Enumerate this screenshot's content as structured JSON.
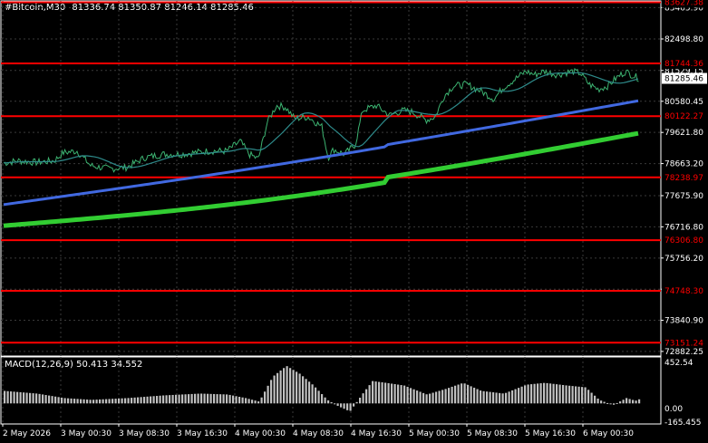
{
  "header": {
    "symbol": "#Bitcoin,M30",
    "open": "81336.74",
    "high": "81350.87",
    "low": "81246.14",
    "close": "81285.46"
  },
  "macd": {
    "label": "MACD(12,26,9)",
    "main": "50.413",
    "signal": "34.552",
    "ticks": [
      "452.54",
      "0.00",
      "-165.455"
    ]
  },
  "price_axis": {
    "ticks": [
      "83465.90",
      "82498.80",
      "81529.15",
      "80580.45",
      "79621.80",
      "78663.20",
      "77675.90",
      "76716.80",
      "75756.20",
      "74797.40",
      "73840.90",
      "72882.25"
    ],
    "current_price": "81285.46"
  },
  "levels": [
    {
      "label": "83627.38",
      "price": 83627.38
    },
    {
      "label": "81744.36",
      "price": 81744.36
    },
    {
      "label": "80122.27",
      "price": 80122.27
    },
    {
      "label": "78238.97",
      "price": 78238.97
    },
    {
      "label": "76306.80",
      "price": 76306.8
    },
    {
      "label": "74748.30",
      "price": 74748.3
    },
    {
      "label": "73151.24",
      "price": 73151.24
    }
  ],
  "time_axis": [
    "2 May 2026",
    "3 May 00:30",
    "3 May 08:30",
    "3 May 16:30",
    "4 May 00:30",
    "4 May 08:30",
    "4 May 16:30",
    "5 May 00:30",
    "5 May 08:30",
    "5 May 16:30",
    "6 May 00:30"
  ],
  "colors": {
    "background": "#000000",
    "grid": "#3a3a3a",
    "level_line": "#ff0000",
    "price_line": "#3cb371",
    "ma_fast": "#2e8b8b",
    "ma_mid": "#4169e1",
    "ma_slow": "#32cd32",
    "macd_hist": "#c0c0c0",
    "macd_signal": "#ff0000"
  }
}
